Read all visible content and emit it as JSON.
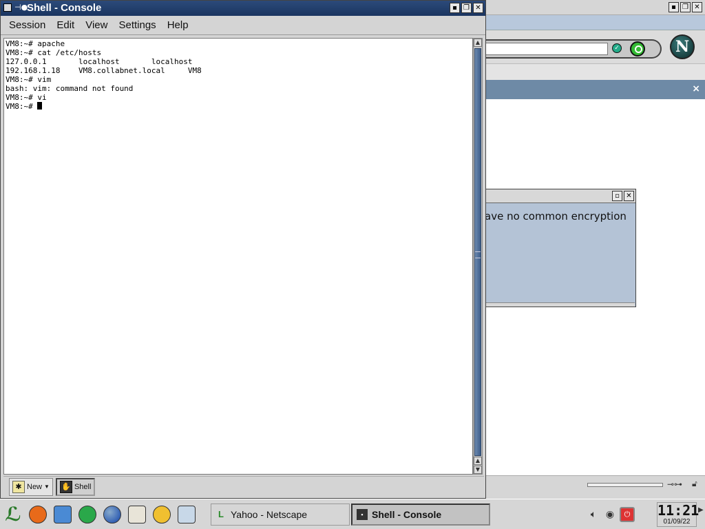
{
  "background_window": {
    "logo_letter": "N",
    "dialog_message": "ave no common encryption",
    "panel_close": "×"
  },
  "konsole": {
    "title": "Shell - Console",
    "menu": [
      "Session",
      "Edit",
      "View",
      "Settings",
      "Help"
    ],
    "terminal_lines": [
      "VM8:~# apache",
      "VM8:~# cat /etc/hosts",
      "127.0.0.1       localhost       localhost",
      "192.168.1.18    VM8.collabnet.local     VM8",
      "VM8:~# vim",
      "bash: vim: command not found",
      "VM8:~# vi",
      "VM8:~# "
    ],
    "tabs": [
      {
        "label": "New",
        "icon": "new-session-icon"
      },
      {
        "label": "Shell",
        "icon": "shell-icon"
      }
    ]
  },
  "taskbar": {
    "launcher_icons": [
      "kde-menu-icon",
      "life-preserver-icon",
      "cube-icon",
      "runner-icon",
      "globe-icon",
      "cards-icon",
      "explorer-icon",
      "pen-icon"
    ],
    "tasks": [
      {
        "label": "Yahoo - Netscape",
        "active": false
      },
      {
        "label": "Shell - Console",
        "active": true
      }
    ],
    "clock_time": "11:21",
    "clock_date": "01/09/22"
  }
}
